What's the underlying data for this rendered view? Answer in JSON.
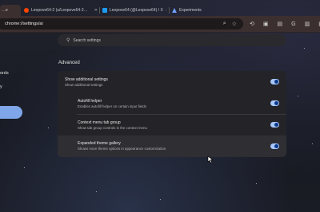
{
  "tabs": [
    {
      "label": "…e",
      "active": true
    },
    {
      "label": "Leopove64-2 (u/Leopove64-2…",
      "active": false
    },
    {
      "label": "Leopove64 (@Leopove64) / X",
      "active": false
    },
    {
      "label": "Experiments",
      "active": false
    }
  ],
  "toolbar": {
    "url": "chrome://settings/ai"
  },
  "sidebar": {
    "items": [
      "ords",
      "y"
    ]
  },
  "search": {
    "placeholder": "Search settings"
  },
  "section": {
    "title": "Advanced"
  },
  "settings": [
    {
      "title": "Show additional settings",
      "subtitle": "Show additional settings",
      "enabled": true
    },
    {
      "title": "Autofill helper",
      "subtitle": "Enables autofill helper on certain input fields",
      "enabled": true
    },
    {
      "title": "Context menu tab group",
      "subtitle": "Show tab group controls in the context menu",
      "enabled": true
    },
    {
      "title": "Expanded theme gallery",
      "subtitle": "Shows more theme options in appearance customization",
      "enabled": true
    }
  ],
  "colors": {
    "toolbar": "#3b2f2f",
    "card": "#242428",
    "toggle_track": "#a8c7fa",
    "toggle_knob": "#0b3a8a",
    "sidebar_selected": "#7fa6e8"
  }
}
